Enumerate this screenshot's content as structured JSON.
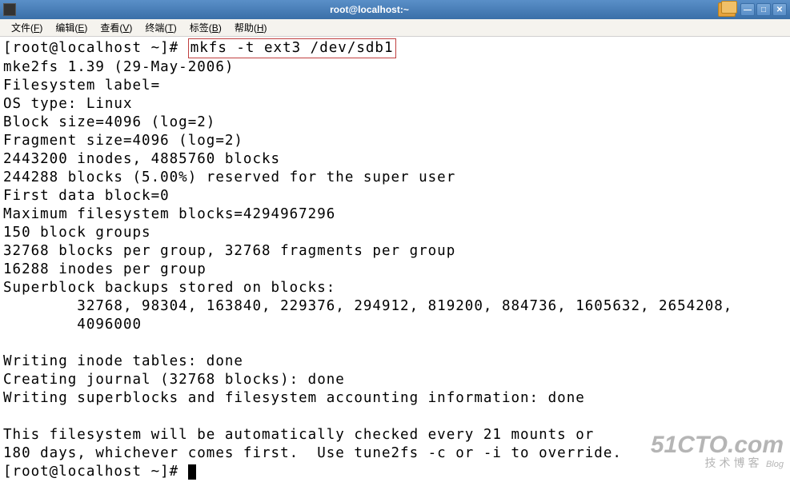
{
  "window": {
    "title": "root@localhost:~"
  },
  "menubar": {
    "items": [
      {
        "label": "文件",
        "accel": "F"
      },
      {
        "label": "编辑",
        "accel": "E"
      },
      {
        "label": "查看",
        "accel": "V"
      },
      {
        "label": "终端",
        "accel": "T"
      },
      {
        "label": "标签",
        "accel": "B"
      },
      {
        "label": "帮助",
        "accel": "H"
      }
    ]
  },
  "terminal": {
    "prompt1": "[root@localhost ~]# ",
    "command": "mkfs -t ext3 /dev/sdb1",
    "lines": [
      "mke2fs 1.39 (29-May-2006)",
      "Filesystem label=",
      "OS type: Linux",
      "Block size=4096 (log=2)",
      "Fragment size=4096 (log=2)",
      "2443200 inodes, 4885760 blocks",
      "244288 blocks (5.00%) reserved for the super user",
      "First data block=0",
      "Maximum filesystem blocks=4294967296",
      "150 block groups",
      "32768 blocks per group, 32768 fragments per group",
      "16288 inodes per group",
      "Superblock backups stored on blocks:",
      "        32768, 98304, 163840, 229376, 294912, 819200, 884736, 1605632, 2654208,",
      "        4096000",
      "",
      "Writing inode tables: done",
      "Creating journal (32768 blocks): done",
      "Writing superblocks and filesystem accounting information: done",
      "",
      "This filesystem will be automatically checked every 21 mounts or",
      "180 days, whichever comes first.  Use tune2fs -c or -i to override."
    ],
    "prompt2": "[root@localhost ~]# "
  },
  "watermark": {
    "big": "51CTO.com",
    "small": "技术博客",
    "blog": "Blog"
  }
}
